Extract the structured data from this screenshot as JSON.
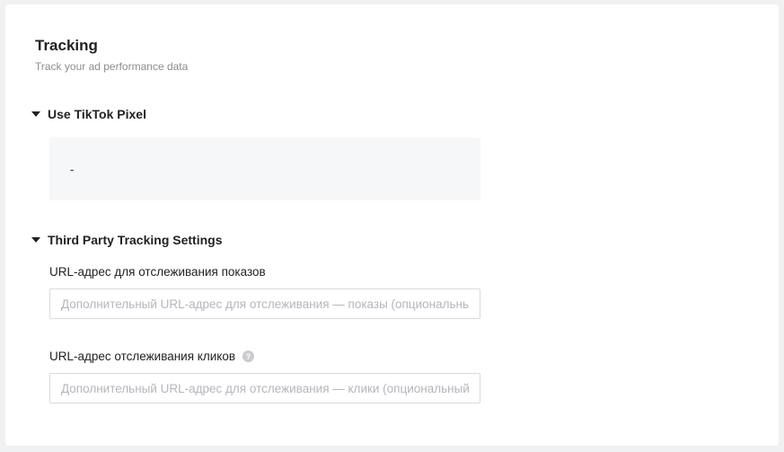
{
  "tracking": {
    "title": "Tracking",
    "subtitle": "Track your ad performance data"
  },
  "pixel_section": {
    "label": "Use TikTok Pixel",
    "value": "-"
  },
  "third_party_section": {
    "label": "Third Party Tracking Settings",
    "impression_url": {
      "label": "URL-адрес для отслеживания показов",
      "placeholder": "Дополнительный URL-адрес для отслеживания — показы (опциональный)",
      "value": ""
    },
    "click_url": {
      "label": "URL-адрес отслеживания кликов",
      "help_icon": "?",
      "placeholder": "Дополнительный URL-адрес для отслеживания — клики (опциональный)",
      "value": ""
    }
  },
  "icons": {
    "caret": "caret-down-icon",
    "help": "question-circle-icon"
  },
  "colors": {
    "background": "#f0f1f2",
    "card": "#ffffff",
    "pixel_box": "#f6f7f8",
    "placeholder": "#b3b6bc",
    "subtitle": "#8a8d93"
  }
}
